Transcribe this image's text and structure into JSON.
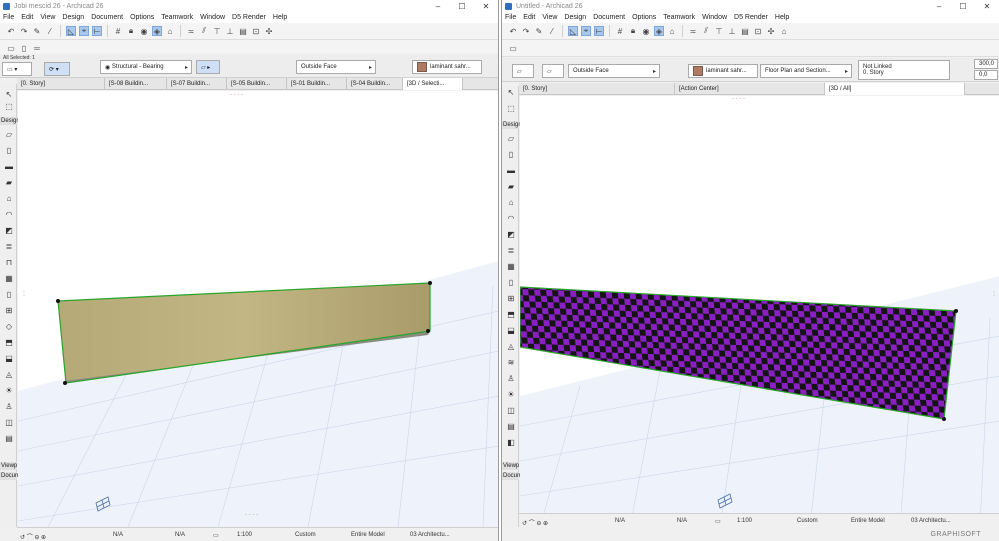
{
  "left_window": {
    "title": "Jobi mescid 26 - Archicad 26",
    "menu": [
      "File",
      "Edit",
      "View",
      "Design",
      "Document",
      "Options",
      "Teamwork",
      "Window",
      "D5 Render",
      "Help"
    ],
    "selection_info": "All Selected: 1",
    "infobox": {
      "structural": "Structural - Bearing",
      "reference": "Outside Face",
      "material": "laminant sahr..."
    },
    "tabs": [
      "[0. Story]",
      "[S-08 Buildin...",
      "[S-07 Buildin...",
      "[S-05 Buildin...",
      "[S-01 Buildin...",
      "[S-04 Buildin...",
      "[3D / Selecti..."
    ],
    "toolbox_groups": [
      "Design",
      "Viewp",
      "Docum"
    ],
    "status": {
      "na1": "N/A",
      "na2": "N/A",
      "scale": "1:100",
      "pen": "Custom",
      "model": "Entire Model",
      "layer": "03 Architectu..."
    },
    "wall_color": "#b9ad7c"
  },
  "right_window": {
    "title": "Untitled - Archicad 26",
    "menu": [
      "File",
      "Edit",
      "View",
      "Design",
      "Document",
      "Options",
      "Teamwork",
      "Window",
      "D5 Render",
      "Help"
    ],
    "infobox": {
      "reference": "Outside Face",
      "material": "laminant sahr...",
      "fp_section": "Floor Plan and Section...",
      "link": "Not Linked",
      "story": "0. Story",
      "height": "300,0",
      "offset": "0,0"
    },
    "tabs": [
      "[0. Story]",
      "[Action Center]",
      "[3D / All]"
    ],
    "toolbox_groups": [
      "Design",
      "Viewp",
      "Docum"
    ],
    "status": {
      "na1": "N/A",
      "na2": "N/A",
      "scale": "1:100",
      "pen": "Custom",
      "model": "Entire Model",
      "layer": "03 Architectu..."
    },
    "brand": "GRAPHISOFT",
    "checker_colors": [
      "#8a1fc4",
      "#141414"
    ]
  },
  "colors": {
    "selection_green": "#2aa52a",
    "grid": "#c9d6ea",
    "ground": "#e9f0fa"
  }
}
